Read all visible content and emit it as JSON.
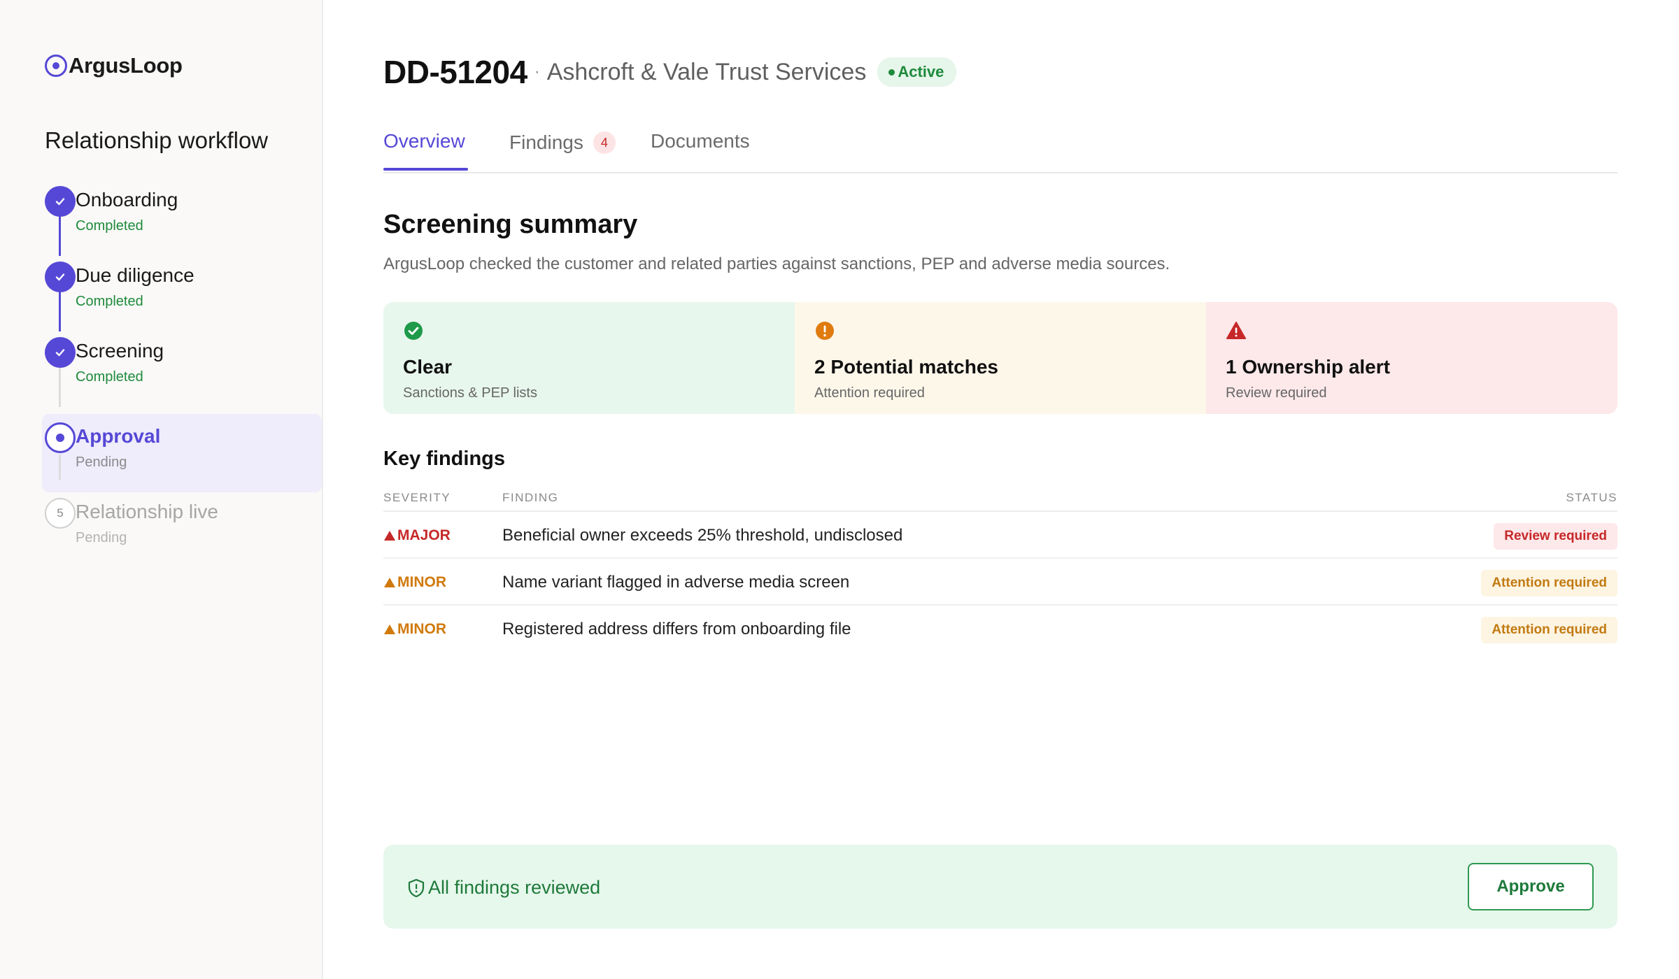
{
  "brand": {
    "name": "ArgusLoop",
    "icon": "target-circle-icon"
  },
  "sidebar": {
    "title": "Relationship workflow",
    "steps": [
      {
        "label": "Onboarding",
        "status": "Completed",
        "state": "done"
      },
      {
        "label": "Due diligence",
        "status": "Completed",
        "state": "done"
      },
      {
        "label": "Screening",
        "status": "Completed",
        "state": "done"
      },
      {
        "label": "Approval",
        "status": "Pending",
        "state": "current"
      },
      {
        "label": "Relationship live",
        "status": "Pending",
        "state": "future",
        "number": "5"
      }
    ]
  },
  "header": {
    "case_id": "DD-51204",
    "separator": "·",
    "entity_name": "Ashcroft & Vale Trust Services",
    "status_badge": "Active"
  },
  "tabs": [
    {
      "label": "Overview",
      "active": true
    },
    {
      "label": "Findings",
      "count": "4"
    },
    {
      "label": "Documents"
    }
  ],
  "summary": {
    "title": "Screening summary",
    "description": "ArgusLoop checked the customer and related parties against sanctions, PEP and adverse media sources.",
    "cards": [
      {
        "title": "Clear",
        "subtitle": "Sanctions & PEP lists",
        "icon": "check-circle-icon",
        "color": "#1e9a4a"
      },
      {
        "title": "2 Potential matches",
        "subtitle": "Attention required",
        "icon": "exclamation-circle-icon",
        "color": "#e07b0f"
      },
      {
        "title": "1 Ownership alert",
        "subtitle": "Review required",
        "icon": "warning-triangle-icon",
        "color": "#c62828"
      }
    ]
  },
  "key_findings": {
    "title": "Key findings",
    "columns": {
      "severity": "SEVERITY",
      "finding": "FINDING",
      "status": "STATUS"
    },
    "rows": [
      {
        "severity": "MAJOR",
        "finding": "Beneficial owner exceeds 25% threshold, undisclosed",
        "status": "Review required"
      },
      {
        "severity": "MINOR",
        "finding": "Name variant flagged in adverse media screen",
        "status": "Attention required"
      },
      {
        "severity": "MINOR",
        "finding": "Registered address differs from onboarding file",
        "status": "Attention required"
      }
    ]
  },
  "footer": {
    "message": "All findings reviewed",
    "icon": "shield-icon",
    "approve_label": "Approve"
  },
  "colors": {
    "accent": "#5648d6",
    "success": "#1e8a3c",
    "warning": "#d07a0c",
    "danger": "#c62828"
  }
}
